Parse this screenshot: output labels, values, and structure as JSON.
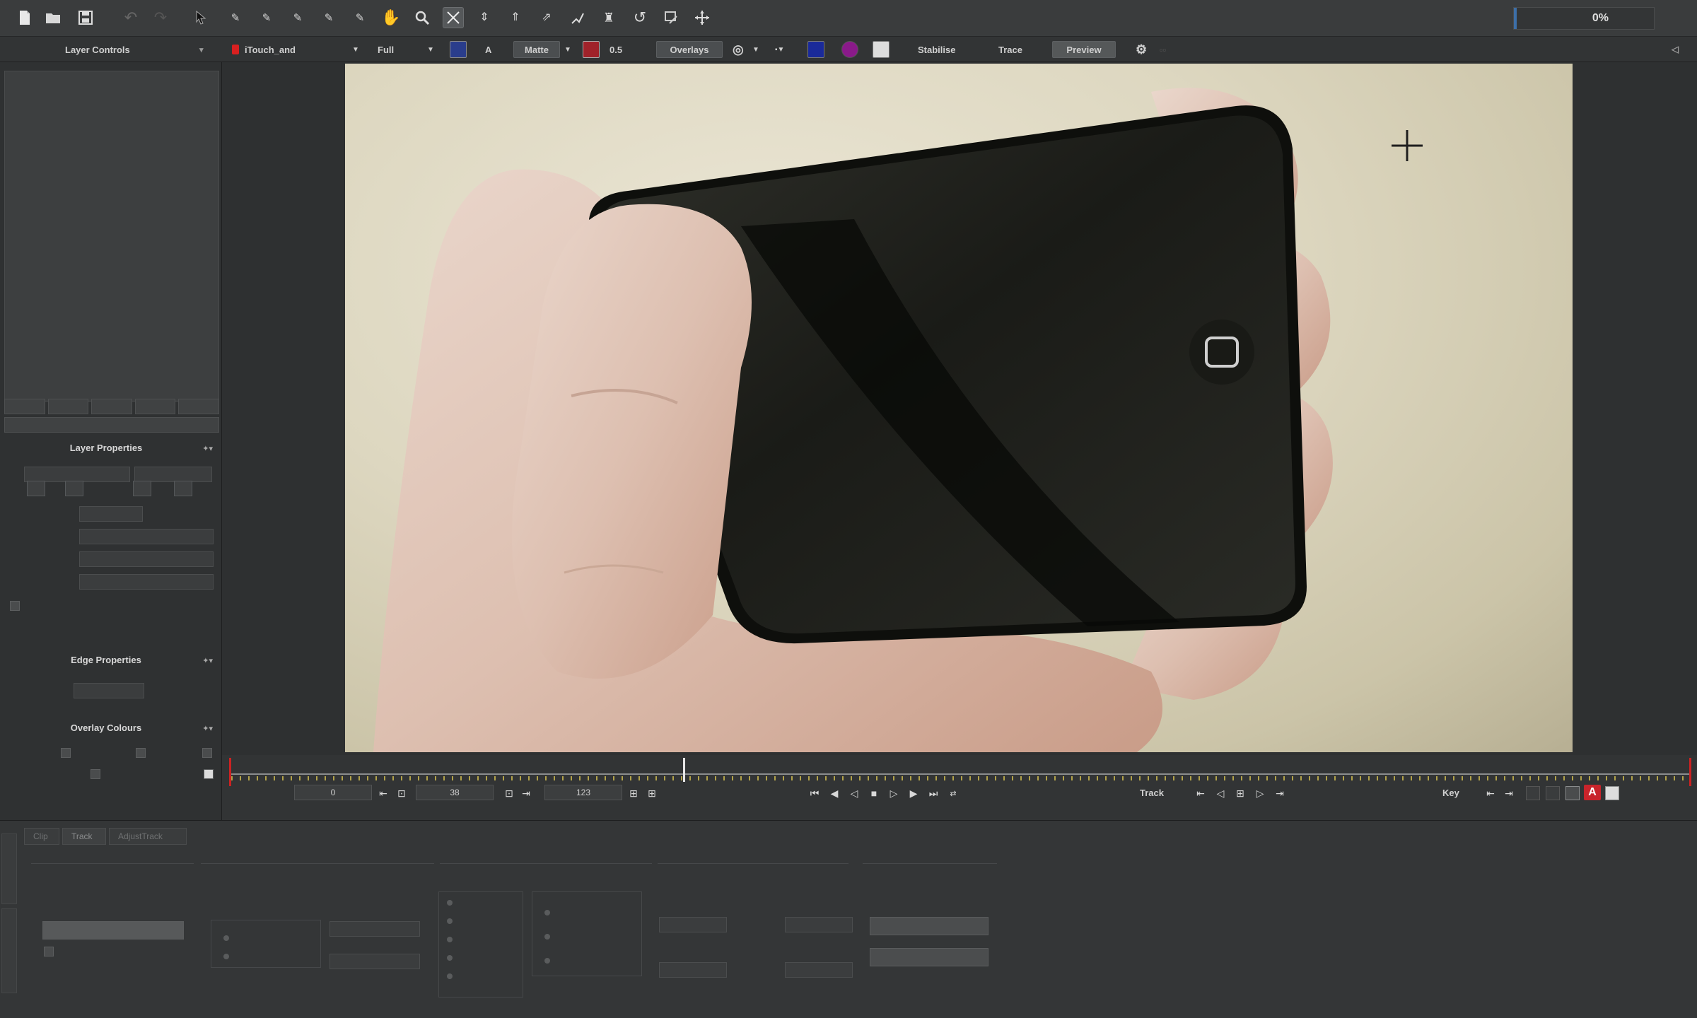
{
  "toolbar": {
    "icons": [
      "new-file-icon",
      "open-folder-icon",
      "save-icon",
      "undo-icon",
      "redo-icon",
      "select-arrow-icon",
      "xspline-icon",
      "bspline-icon",
      "add-point-icon",
      "remove-point-icon",
      "tangent-icon",
      "hand-icon",
      "zoom-icon",
      "transform-icon",
      "scale-icon",
      "rotate-icon",
      "shear-icon",
      "perspective-icon",
      "corner-pin-icon",
      "reset-icon",
      "surface-icon",
      "move-icon"
    ],
    "progress_value": 0.02,
    "progress_label": "0%"
  },
  "subbar": {
    "layer_controls_title": "Layer Controls",
    "clip_name": "iTouch_and",
    "resolution": "Full",
    "a_label": "A",
    "view_mode": "Matte",
    "opacity": "0.5",
    "overlays_label": "Overlays",
    "stabilise_label": "Stabilise",
    "trace_label": "Trace",
    "preview_label": "Preview",
    "colors": {
      "clip_dot": "#d92020",
      "overlay_blue": "#1a2a9a",
      "overlay_purple": "#8a1a8a"
    }
  },
  "left_panel": {
    "layer_properties_title": "Layer Properties",
    "edge_properties_title": "Edge Properties",
    "overlay_colours_title": "Overlay Colours"
  },
  "timeline": {
    "start_frame": "0",
    "current_frame": "38",
    "end_frame": "123",
    "playhead_fraction": 0.31,
    "track_label": "Track",
    "key_label": "Key",
    "key_a": "A",
    "colors": {
      "range_marker": "#cc2222",
      "ticks": "#b3a349"
    }
  },
  "bottom": {
    "tabs": [
      "Clip",
      "Track",
      "AdjustTrack"
    ]
  }
}
